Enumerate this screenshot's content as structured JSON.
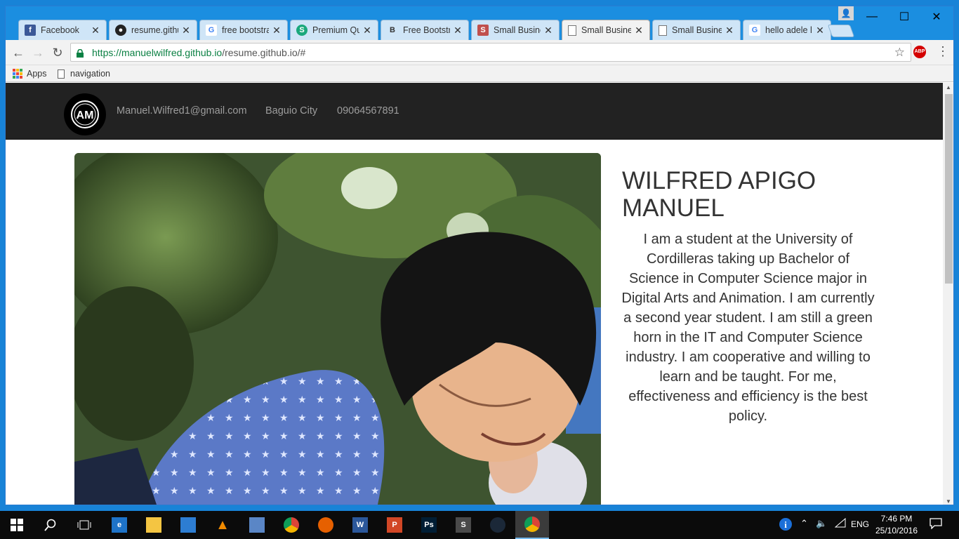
{
  "browser": {
    "tabs": [
      {
        "title": "Facebook",
        "icon": "facebook-icon",
        "color": "#3b5998",
        "glyph": "f"
      },
      {
        "title": "resume.githu",
        "icon": "github-icon",
        "color": "#222222",
        "glyph": "●"
      },
      {
        "title": "free bootstra",
        "icon": "google-icon",
        "color": "#4285f4",
        "glyph": "G"
      },
      {
        "title": "Premium Qu",
        "icon": "site-icon",
        "color": "#1aa87c",
        "glyph": "S"
      },
      {
        "title": "Free Bootstra",
        "icon": "bootstrap-icon",
        "color": "#333333",
        "glyph": "B"
      },
      {
        "title": "Small Busine",
        "icon": "startbootstrap-icon",
        "color": "#c0504d",
        "glyph": "S"
      },
      {
        "title": "Small Busine",
        "icon": "document-icon",
        "color": "#ffffff",
        "glyph": ""
      },
      {
        "title": "Small Busine",
        "icon": "document-icon",
        "color": "#ffffff",
        "glyph": ""
      },
      {
        "title": "hello adele l",
        "icon": "google-icon",
        "color": "#4285f4",
        "glyph": "G"
      }
    ],
    "active_tab": 6,
    "url_host": "https://manuelwilfred.github.io",
    "url_path": "/resume.github.io/#",
    "bookmarks": [
      {
        "label": "Apps"
      },
      {
        "label": "navigation"
      }
    ],
    "abp_label": "ABP"
  },
  "site": {
    "nav": {
      "email": "Manuel.Wilfred1@gmail.com",
      "city": "Baguio City",
      "phone": "09064567891"
    },
    "name": "WILFRED APIGO MANUEL",
    "bio": "I am a student at the University of Cordilleras taking up Bachelor of Science in Computer Science major in Digital Arts and Animation. I am currently a second year student. I am still a green horn in the IT and Computer Science industry. I am cooperative and willing to learn and be taught. For me, effectiveness and efficiency is the best policy."
  },
  "taskbar": {
    "time": "7:46 PM",
    "date": "25/10/2016",
    "language": "ENG",
    "apps": [
      {
        "name": "edge",
        "color": "#1e73c8",
        "glyph": "e"
      },
      {
        "name": "file-explorer",
        "color": "#f4c542",
        "glyph": ""
      },
      {
        "name": "store",
        "color": "#2d7dd2",
        "glyph": ""
      },
      {
        "name": "vlc",
        "color": "#f08a00",
        "glyph": "▲"
      },
      {
        "name": "virtualbox",
        "color": "#5a86c6",
        "glyph": ""
      },
      {
        "name": "chrome",
        "color": "#db4437",
        "glyph": ""
      },
      {
        "name": "firefox",
        "color": "#e66000",
        "glyph": ""
      },
      {
        "name": "word",
        "color": "#2b579a",
        "glyph": "W"
      },
      {
        "name": "powerpoint",
        "color": "#d24726",
        "glyph": "P"
      },
      {
        "name": "photoshop",
        "color": "#001d34",
        "glyph": "Ps"
      },
      {
        "name": "sublime-text",
        "color": "#4a4a4a",
        "glyph": "S"
      },
      {
        "name": "steam",
        "color": "#1b2838",
        "glyph": ""
      },
      {
        "name": "chrome",
        "color": "#db4437",
        "glyph": ""
      }
    ]
  }
}
